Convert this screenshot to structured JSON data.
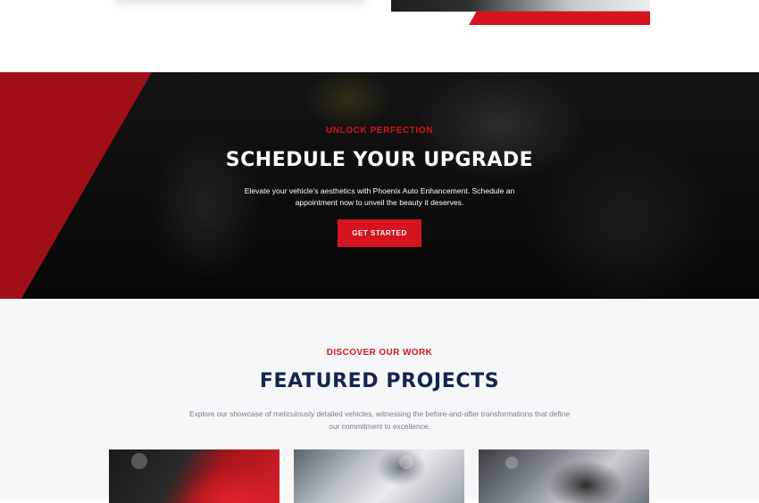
{
  "cta": {
    "eyebrow": "UNLOCK PERFECTION",
    "title": "SCHEDULE YOUR UPGRADE",
    "body": "Elevate your vehicle's aesthetics with Phoenix Auto Enhancement. Schedule an appointment now to unveil the beauty it deserves.",
    "button_label": "GET STARTED"
  },
  "projects": {
    "eyebrow": "DISCOVER OUR WORK",
    "title": "FEATURED PROJECTS",
    "body": "Explore our showcase of meticulously detailed vehicles, witnessing the before-and-after transformations that define our commitment to excellence."
  },
  "colors": {
    "accent": "#d6141f",
    "heading": "#14244f",
    "section_bg": "#f6f7f9"
  }
}
